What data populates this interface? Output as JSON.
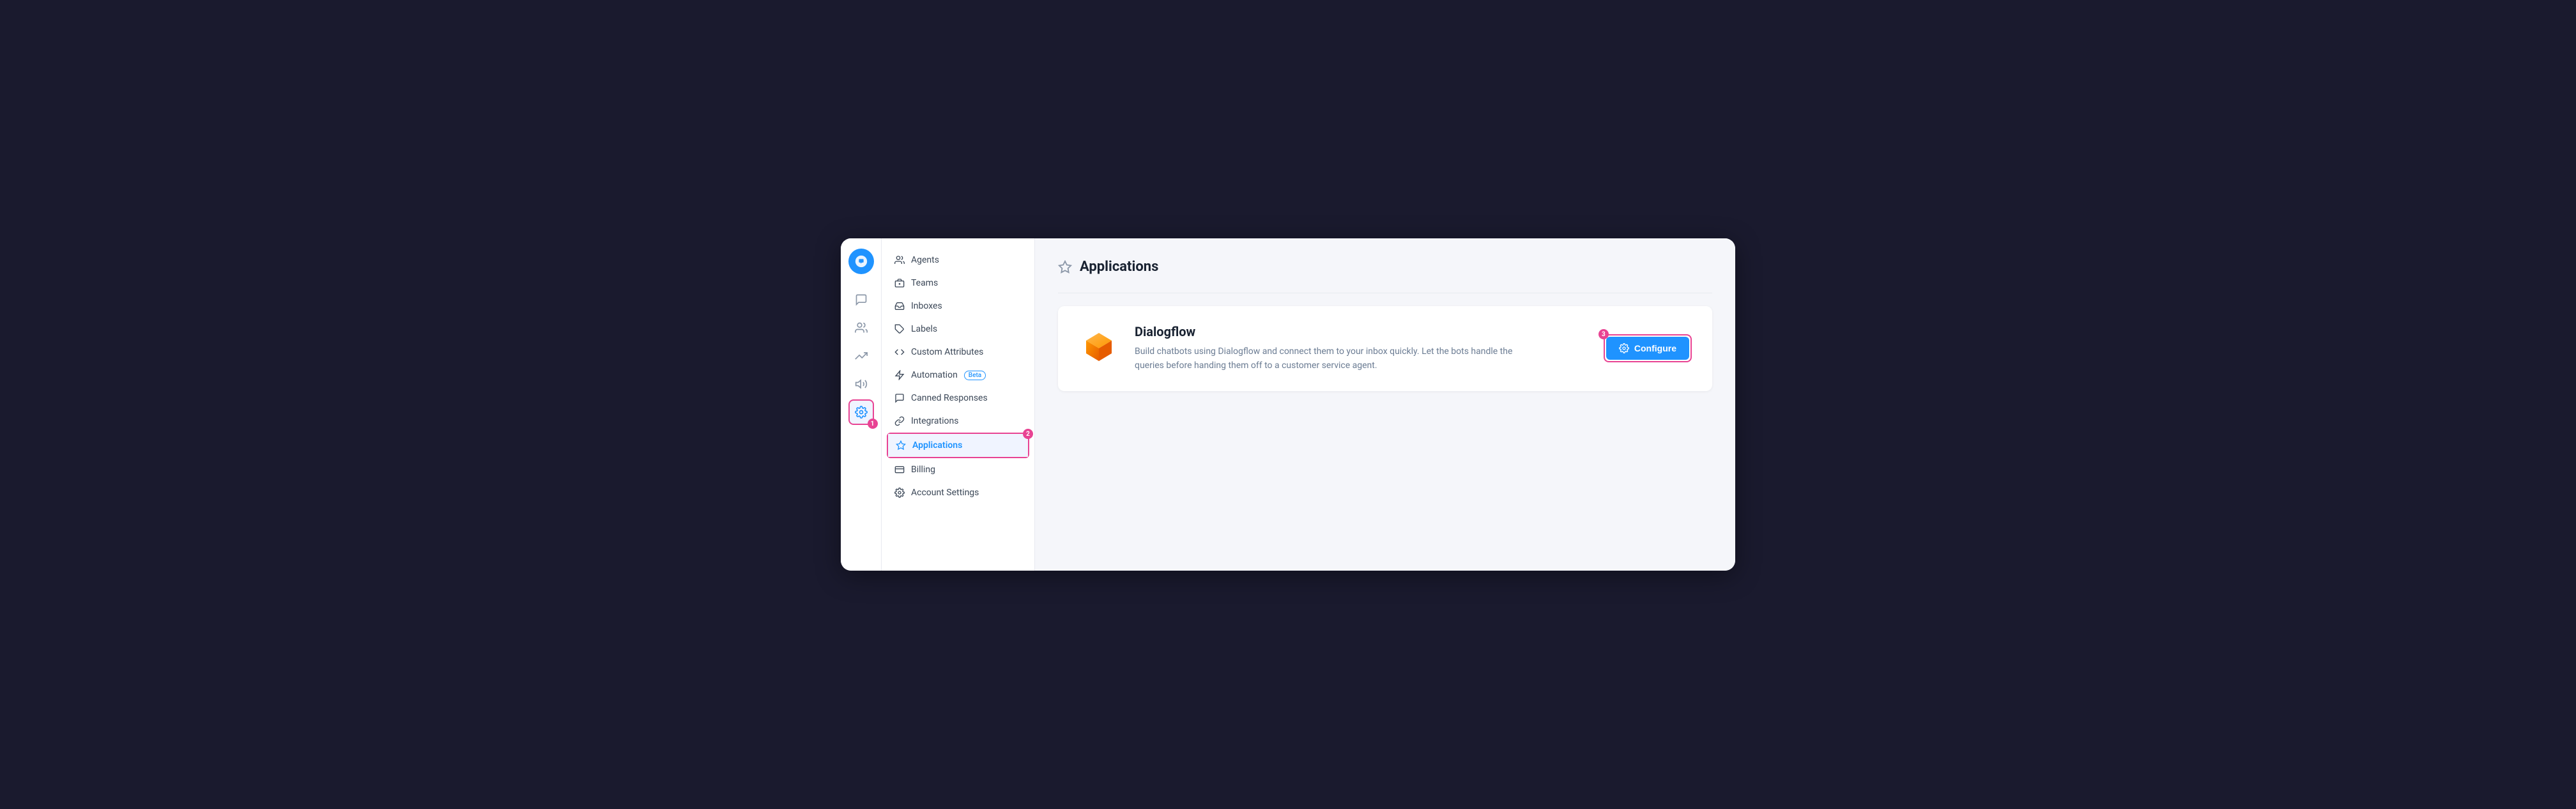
{
  "window": {
    "title": "Applications"
  },
  "logo": {
    "label": "Chatwoot"
  },
  "iconSidebar": {
    "icons": [
      {
        "name": "chat-icon",
        "symbol": "💬",
        "active": false
      },
      {
        "name": "inbox-icon",
        "symbol": "📥",
        "active": false
      },
      {
        "name": "reports-icon",
        "symbol": "📊",
        "active": false
      },
      {
        "name": "campaigns-icon",
        "symbol": "📣",
        "active": false
      },
      {
        "name": "settings-icon",
        "symbol": "⚙️",
        "active": true
      }
    ]
  },
  "navSidebar": {
    "items": [
      {
        "id": "agents",
        "label": "Agents",
        "icon": "agents-icon"
      },
      {
        "id": "teams",
        "label": "Teams",
        "icon": "teams-icon"
      },
      {
        "id": "inboxes",
        "label": "Inboxes",
        "icon": "inboxes-icon"
      },
      {
        "id": "labels",
        "label": "Labels",
        "icon": "labels-icon"
      },
      {
        "id": "custom-attributes",
        "label": "Custom Attributes",
        "icon": "custom-attr-icon"
      },
      {
        "id": "automation",
        "label": "Automation",
        "icon": "automation-icon",
        "badge": "Beta"
      },
      {
        "id": "canned-responses",
        "label": "Canned Responses",
        "icon": "canned-icon"
      },
      {
        "id": "integrations",
        "label": "Integrations",
        "icon": "integrations-icon"
      },
      {
        "id": "applications",
        "label": "Applications",
        "icon": "applications-icon",
        "active": true,
        "highlighted": true,
        "badgeNum": "2"
      },
      {
        "id": "billing",
        "label": "Billing",
        "icon": "billing-icon"
      },
      {
        "id": "account-settings",
        "label": "Account Settings",
        "icon": "account-settings-icon"
      }
    ]
  },
  "mainContent": {
    "pageTitle": "Applications",
    "cards": [
      {
        "id": "dialogflow",
        "title": "Dialogflow",
        "description": "Build chatbots using Dialogflow and connect them to your inbox quickly. Let the bots handle the queries before handing them off to a customer service agent.",
        "configureLabel": "Configure"
      }
    ]
  },
  "badges": {
    "icon1": "1",
    "nav2": "2",
    "configure3": "3"
  }
}
